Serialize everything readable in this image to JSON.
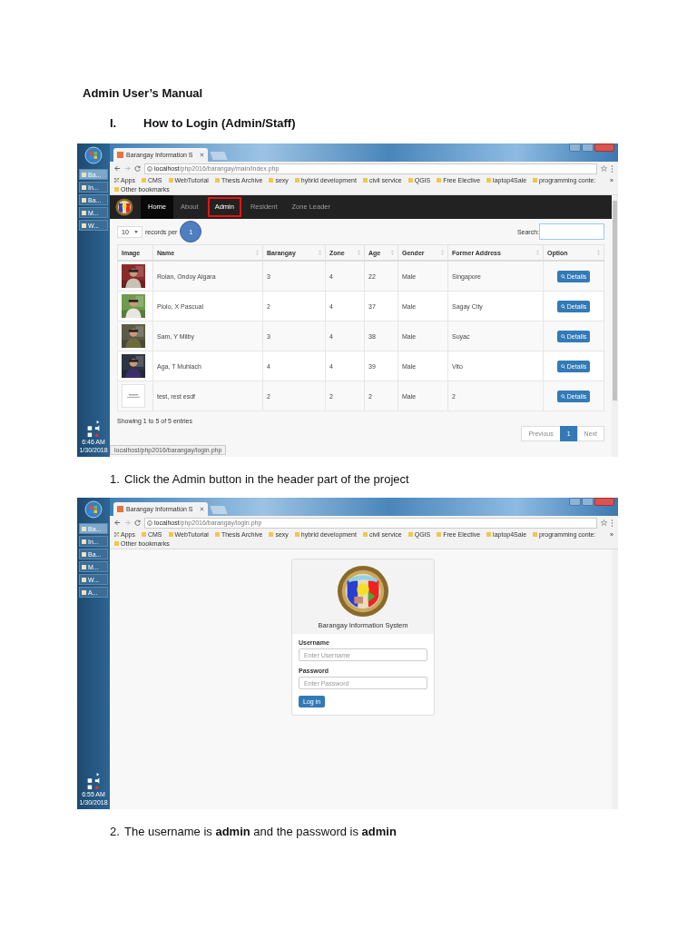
{
  "heading": "Admin User’s Manual",
  "section": {
    "number": "I.",
    "title": "How to Login (Admin/Staff)"
  },
  "figures": [
    {
      "screen": {
        "kind": "resident_list",
        "taskbar": {
          "items": [
            {
              "label": "Ba...",
              "selected": true
            },
            {
              "label": "In...",
              "selected": false
            },
            {
              "label": "Ba...",
              "selected": false
            },
            {
              "label": "M...",
              "selected": false
            },
            {
              "label": "W...",
              "selected": false
            }
          ],
          "time": "6:46 AM",
          "date": "1/30/2018"
        },
        "tab_title": "Barangay Information S",
        "url": "localhost/php2016/barangay/main/index.php",
        "bookmarks": [
          {
            "label": "Apps",
            "kind": "apps"
          },
          {
            "label": "CMS",
            "kind": "folder"
          },
          {
            "label": "WebTutorial",
            "kind": "folder"
          },
          {
            "label": "Thesis Archive",
            "kind": "folder"
          },
          {
            "label": "sexy",
            "kind": "folder"
          },
          {
            "label": "hybrid development",
            "kind": "folder"
          },
          {
            "label": "civil service",
            "kind": "folder"
          },
          {
            "label": "QGIS",
            "kind": "folder"
          },
          {
            "label": "Free Elective",
            "kind": "folder"
          },
          {
            "label": "laptop4Sale",
            "kind": "folder"
          },
          {
            "label": "programming conte:",
            "kind": "folder"
          }
        ],
        "bookmarks_more": "»",
        "other_bookmarks": "Other bookmarks",
        "nav": [
          {
            "label": "Home",
            "selected": true,
            "highlighted": false
          },
          {
            "label": "About",
            "selected": false,
            "highlighted": false
          },
          {
            "label": "Admin",
            "selected": false,
            "highlighted": true
          },
          {
            "label": "Resident",
            "selected": false,
            "highlighted": false
          },
          {
            "label": "Zone Leader",
            "selected": false,
            "highlighted": false
          }
        ],
        "annotation": "1",
        "length": "10",
        "length_label": "records per",
        "search_label": "Search:",
        "columns": [
          "Image",
          "Name",
          "Barangay",
          "Zone",
          "Age",
          "Gender",
          "Former Address",
          "Option"
        ],
        "rows": [
          {
            "cells": [
              "",
              "Rolan, Ondoy Algara",
              "3",
              "4",
              "22",
              "Male",
              "Singapore",
              "Details"
            ]
          },
          {
            "cells": [
              "",
              "Piolo, X Pascual",
              "2",
              "4",
              "37",
              "Male",
              "Sagay City",
              "Details"
            ]
          },
          {
            "cells": [
              "",
              "Sam, Y Milby",
              "3",
              "4",
              "38",
              "Male",
              "Suyac",
              "Details"
            ]
          },
          {
            "cells": [
              "",
              "Aga, T Muhlach",
              "4",
              "4",
              "39",
              "Male",
              "Vito",
              "Details"
            ]
          },
          {
            "kind": "placeholder",
            "cells": [
              "",
              "test, rest esdf",
              "2",
              "2",
              "2",
              "Male",
              "2",
              "Details"
            ]
          }
        ],
        "info": "Showing 1 to 5 of 5 entries",
        "pages": [
          {
            "label": "Previous",
            "selected": false
          },
          {
            "label": "1",
            "selected": true
          },
          {
            "label": "Next",
            "selected": false
          }
        ],
        "status": "localhost/php2016/barangay/login.php"
      },
      "caption": {
        "number": "1.",
        "text": "Click the Admin button in the header part of the project"
      }
    },
    {
      "screen": {
        "kind": "login",
        "taskbar": {
          "items": [
            {
              "label": "Ba...",
              "selected": true
            },
            {
              "label": "In...",
              "selected": false
            },
            {
              "label": "Ba...",
              "selected": false
            },
            {
              "label": "M...",
              "selected": false
            },
            {
              "label": "W...",
              "selected": false
            },
            {
              "label": "A...",
              "selected": false
            }
          ],
          "time": "6:55 AM",
          "date": "1/30/2018"
        },
        "tab_title": "Barangay Information S",
        "url": "localhost/php2016/barangay/login.php",
        "bookmarks": [
          {
            "label": "Apps",
            "kind": "apps"
          },
          {
            "label": "CMS",
            "kind": "folder"
          },
          {
            "label": "WebTutorial",
            "kind": "folder"
          },
          {
            "label": "Thesis Archive",
            "kind": "folder"
          },
          {
            "label": "sexy",
            "kind": "folder"
          },
          {
            "label": "hybrid development",
            "kind": "folder"
          },
          {
            "label": "civil service",
            "kind": "folder"
          },
          {
            "label": "QGIS",
            "kind": "folder"
          },
          {
            "label": "Free Elective",
            "kind": "folder"
          },
          {
            "label": "laptop4Sale",
            "kind": "folder"
          },
          {
            "label": "programming conte:",
            "kind": "folder"
          }
        ],
        "bookmarks_more": "»",
        "other_bookmarks": "Other bookmarks",
        "card": {
          "title": "Barangay Information System",
          "fields": [
            {
              "label": "Username",
              "placeholder": "Enter Username"
            },
            {
              "label": "Password",
              "placeholder": "Enter Password"
            }
          ],
          "button": "Log in"
        }
      },
      "caption": {
        "number": "2.",
        "text": "The username is **admin** and the password is **admin**"
      }
    }
  ]
}
